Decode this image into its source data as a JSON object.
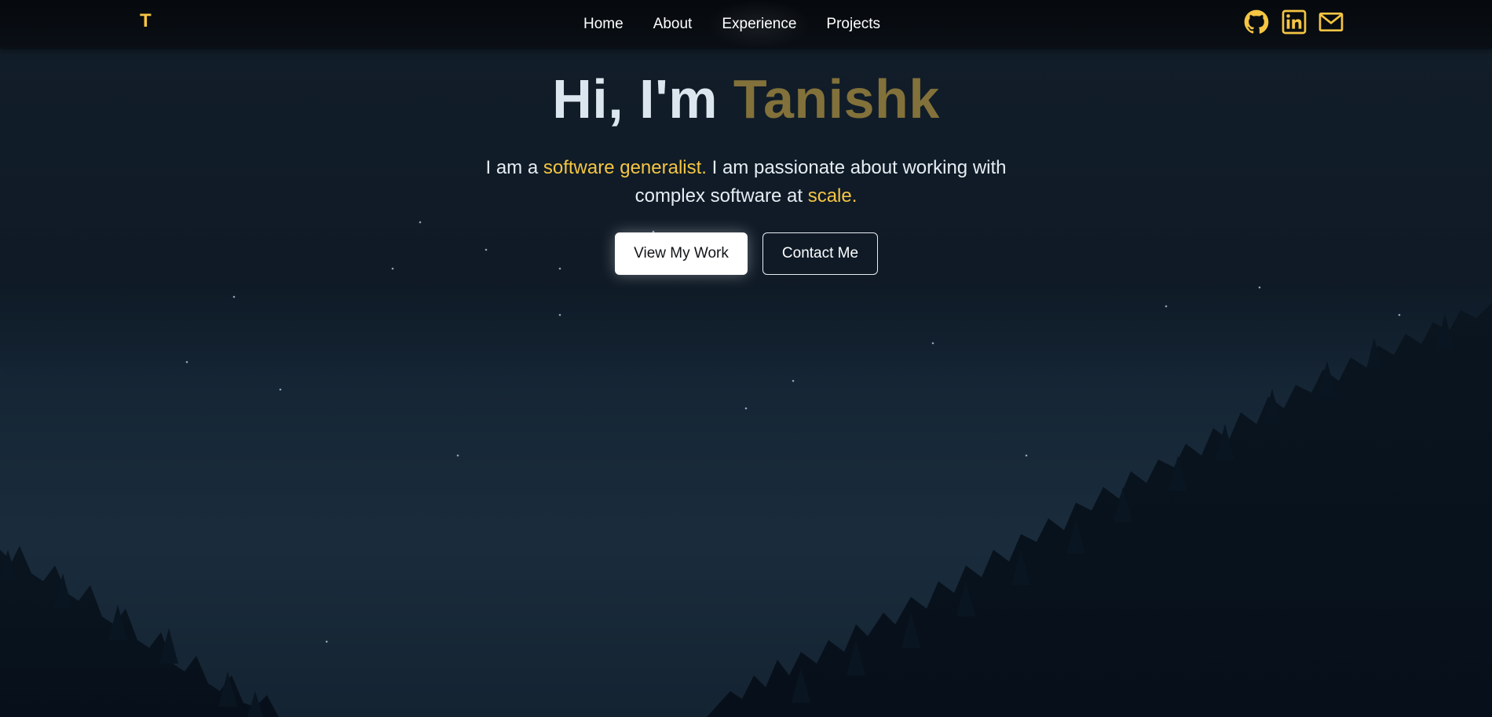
{
  "nav": {
    "logo": "T",
    "links": [
      {
        "label": "Home"
      },
      {
        "label": "About"
      },
      {
        "label": "Experience"
      },
      {
        "label": "Projects"
      }
    ],
    "social": [
      {
        "icon": "github-icon"
      },
      {
        "icon": "linkedin-icon"
      },
      {
        "icon": "mail-icon"
      }
    ]
  },
  "hero": {
    "greeting": "Hi, I'm ",
    "name": "Tanishk",
    "desc_1": "I am a ",
    "desc_accent_1": "software generalist.",
    "desc_2": " I am passionate about working with complex software at ",
    "desc_accent_2": "scale.",
    "primary_button": "View My Work",
    "secondary_button": "Contact Me"
  },
  "colors": {
    "accent": "#f5c543",
    "name": "#82713a",
    "nav_bg": "#06090d",
    "sky": "#122130"
  }
}
